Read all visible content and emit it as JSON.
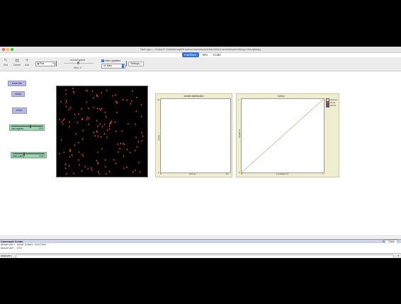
{
  "window": {
    "title": "NetLogo — lesson7 (/Users/ragt/Dropbox/canvaspack/bar/ctionz-workshops/netlogo changlang)",
    "traffic_lights": [
      "#ff5f57",
      "#febc2e",
      "#28c840"
    ]
  },
  "tabs": [
    {
      "label": "Interface",
      "active": true
    },
    {
      "label": "Info",
      "active": false
    },
    {
      "label": "Code",
      "active": false
    }
  ],
  "toolbar": {
    "edit_label": "Edit",
    "delete_label": "Delete",
    "add_label": "Add",
    "widget_type": "Plot",
    "speed_label": "normal speed",
    "speed_caption": "ticks: 0",
    "view_updates_label": "view updates",
    "view_updates_checked": true,
    "update_mode": "on ticks",
    "settings_label": "Settings..."
  },
  "widgets": {
    "save_file_label": "save-file",
    "setup_label": "setup",
    "step_label": "step",
    "sliders": [
      {
        "name": "num-agents",
        "value": "274",
        "fraction": 0.6
      },
      {
        "name": "total-money",
        "value": "2,947",
        "fraction": 0.35
      }
    ]
  },
  "plots": {
    "wealth": {
      "title": "wealth distribution",
      "xlabel": "fortune",
      "ylabel": "turtles",
      "xmin": "0",
      "xmax": "10",
      "ymin": "0",
      "ymax": "10"
    },
    "lorenz": {
      "title": "lorenz",
      "xlabel": "population %",
      "ylabel": "wealth %",
      "xmin": "0",
      "xmax": "1",
      "ymin": "0",
      "ymax": "1",
      "legend": [
        {
          "name": "optimal",
          "color": "#dedede"
        },
        {
          "name": "worst",
          "color": "#d9413a"
        },
        {
          "name": "lorenz",
          "color": "#6c4aa2"
        }
      ]
    }
  },
  "chart_data": {
    "type": "line",
    "title": "lorenz",
    "xlabel": "population %",
    "ylabel": "wealth %",
    "xlim": [
      0,
      1
    ],
    "ylim": [
      0,
      1
    ],
    "series": [
      {
        "name": "optimal",
        "x": [
          0,
          1
        ],
        "y": [
          0,
          1
        ],
        "color": "#c8b48a"
      }
    ]
  },
  "command_center": {
    "title": "Command Center",
    "clear_label": "Clear",
    "lines": [
      "observer> show count turtles",
      "observer: 274"
    ],
    "agent": "observer>"
  },
  "colors": {
    "button": "#b7b9e7",
    "slider": "#9fd1b3",
    "plot_bg": "#efefcf",
    "turtle": "#d9413a"
  }
}
